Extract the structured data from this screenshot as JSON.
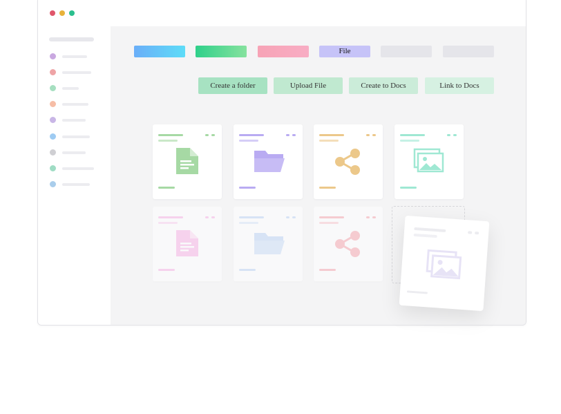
{
  "colors": {
    "window_dots": [
      "#e0566b",
      "#e8b23a",
      "#2bbf8e"
    ],
    "sidebar_dots": [
      "#c9a8e0",
      "#eea4a6",
      "#a6dfc0",
      "#f6bda6",
      "#c9b6e6",
      "#9ecbf2",
      "#cfcfd3",
      "#9fdcc4",
      "#a9cdeb"
    ],
    "tabs": [
      "#6aaef8",
      "#2fd08a",
      "#f7a3b6",
      "#c6c3f8",
      "#e5e5ea",
      "#e5e5ea"
    ],
    "actions": [
      "#a7e2c2",
      "#c0e9d0",
      "#cbecd9",
      "#d6f1e2"
    ],
    "cards": [
      "#a6d9a4",
      "#b9abf2",
      "#ecc88a",
      "#9fe8d3",
      "#f8b2e6",
      "#bcd4f6",
      "#f7a3ad"
    ]
  },
  "tabs": [
    {
      "label": ""
    },
    {
      "label": ""
    },
    {
      "label": ""
    },
    {
      "label": "File"
    },
    {
      "label": ""
    },
    {
      "label": ""
    }
  ],
  "actions": [
    {
      "label": "Create a folder"
    },
    {
      "label": "Upload File"
    },
    {
      "label": "Create to Docs"
    },
    {
      "label": "Link to Docs"
    }
  ],
  "cards": [
    {
      "icon": "document-icon"
    },
    {
      "icon": "folder-icon"
    },
    {
      "icon": "share-icon"
    },
    {
      "icon": "image-icon"
    },
    {
      "icon": "document-icon"
    },
    {
      "icon": "folder-icon"
    },
    {
      "icon": "share-icon"
    }
  ],
  "drag_card": {
    "icon": "image-icon"
  }
}
